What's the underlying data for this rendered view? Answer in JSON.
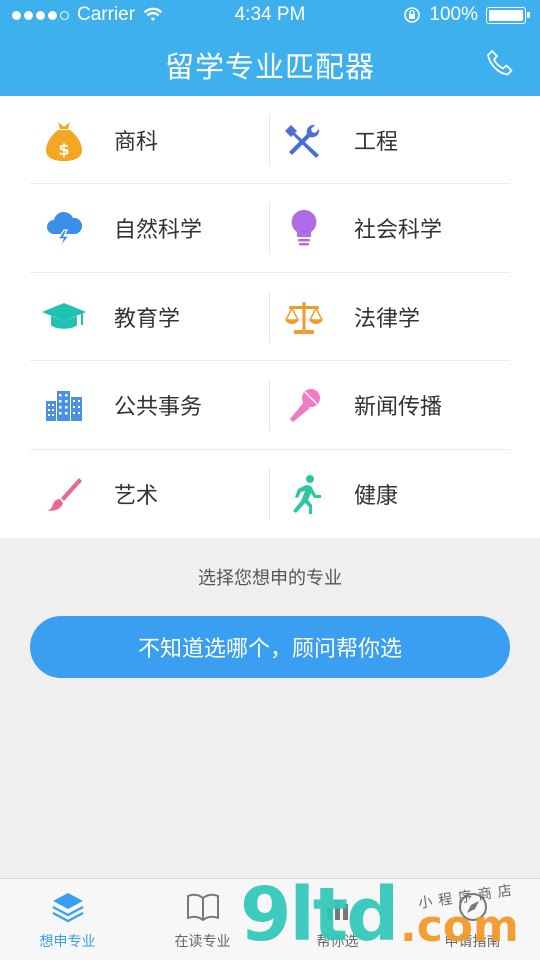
{
  "status_bar": {
    "carrier": "Carrier",
    "time": "4:34 PM",
    "battery": "100%"
  },
  "header": {
    "title": "留学专业匹配器"
  },
  "majors": [
    {
      "label": "商科",
      "icon": "money-bag-icon"
    },
    {
      "label": "工程",
      "icon": "tools-icon"
    },
    {
      "label": "自然科学",
      "icon": "cloud-lightning-icon"
    },
    {
      "label": "社会科学",
      "icon": "lightbulb-icon"
    },
    {
      "label": "教育学",
      "icon": "graduation-cap-icon"
    },
    {
      "label": "法律学",
      "icon": "scales-icon"
    },
    {
      "label": "公共事务",
      "icon": "buildings-icon"
    },
    {
      "label": "新闻传播",
      "icon": "microphone-icon"
    },
    {
      "label": "艺术",
      "icon": "paintbrush-icon"
    },
    {
      "label": "健康",
      "icon": "runner-icon"
    }
  ],
  "hint": "选择您想申的专业",
  "cta_label": "不知道选哪个，顾问帮你选",
  "tabs": [
    {
      "label": "想申专业",
      "icon": "layers-icon",
      "active": true
    },
    {
      "label": "在读专业",
      "icon": "book-icon",
      "active": false
    },
    {
      "label": "帮你选",
      "icon": "chart-icon",
      "active": false
    },
    {
      "label": "申请指南",
      "icon": "compass-icon",
      "active": false
    }
  ],
  "watermark": {
    "brand": "9ltd",
    "suffix": ".com",
    "tagline": "小程序商店"
  },
  "colors": {
    "header": "#3fb0ee",
    "accent": "#3a9ff0",
    "business": "#f5a623",
    "engineering": "#4a6fd6",
    "science": "#3a8fe8",
    "social": "#b06be8",
    "education": "#1fc2b1",
    "law": "#f39a2b",
    "public": "#4a90e2",
    "journalism": "#f07ac8",
    "art": "#e86a8c",
    "health": "#2cc7a0"
  }
}
